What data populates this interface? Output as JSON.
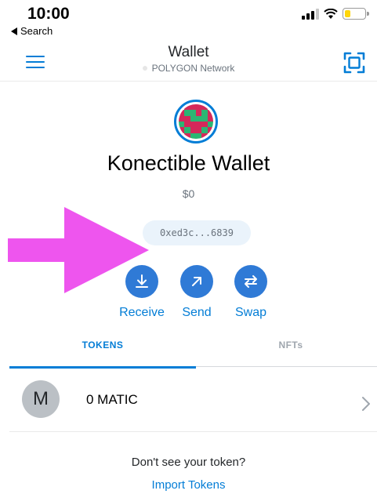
{
  "status_bar": {
    "time": "10:00",
    "back_label": "Search",
    "signal_icon": "cellular-signal-icon",
    "wifi_icon": "wifi-icon",
    "battery_icon": "battery-icon",
    "battery_level": 0.3,
    "battery_color": "#ffd60a"
  },
  "header": {
    "title": "Wallet",
    "network": "POLYGON Network",
    "menu_icon": "hamburger-menu-icon",
    "scan_icon": "scan-qr-icon"
  },
  "account": {
    "name": "Konectible Wallet",
    "balance": "$0",
    "address": "0xed3c...6839",
    "avatar_icon": "identicon-avatar"
  },
  "actions": [
    {
      "label": "Receive",
      "icon": "download-icon"
    },
    {
      "label": "Send",
      "icon": "arrow-up-right-icon"
    },
    {
      "label": "Swap",
      "icon": "swap-arrows-icon"
    }
  ],
  "tabs": [
    {
      "label": "TOKENS",
      "active": true
    },
    {
      "label": "NFTs",
      "active": false
    }
  ],
  "tokens": [
    {
      "icon_letter": "M",
      "balance": "0 MATIC"
    }
  ],
  "footer": {
    "prompt": "Don't see your token?",
    "import_label": "Import Tokens"
  },
  "colors": {
    "accent": "#037dd6",
    "action_button": "#2f7ad6",
    "overlay_arrow": "#ee55ee",
    "identicon_primary": "#d4285a",
    "identicon_secondary": "#2bb673"
  }
}
